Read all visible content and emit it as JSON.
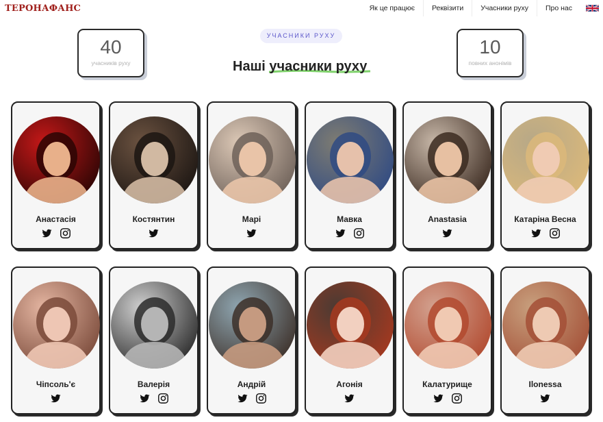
{
  "header": {
    "logo": "ТЕРОНАФАНС",
    "nav": [
      "Як це працює",
      "Реквізити",
      "Учасники руху",
      "Про нас"
    ],
    "language_flag": "uk-flag-icon"
  },
  "stats": {
    "members": {
      "value": "40",
      "label": "учасників руху"
    },
    "anonymous": {
      "value": "10",
      "label": "повних анонімів"
    }
  },
  "section": {
    "tag": "УЧАСНИКИ РУХУ",
    "title": "Наші учасники руху"
  },
  "colors": {
    "accent": "#5a55c9",
    "underline": "#7fd16b",
    "logo": "#a0201c"
  },
  "members": [
    {
      "name": "Анастасія",
      "twitter": true,
      "instagram": true,
      "photo_colors": [
        "#c41818",
        "#2a0504",
        "#e8b08a"
      ]
    },
    {
      "name": "Костянтин",
      "twitter": true,
      "instagram": false,
      "photo_colors": [
        "#6b5240",
        "#1b1512",
        "#d1b9a2"
      ]
    },
    {
      "name": "Марі",
      "twitter": true,
      "instagram": false,
      "photo_colors": [
        "#dcc8b6",
        "#6d6058",
        "#e9c4a8"
      ]
    },
    {
      "name": "Мавка",
      "twitter": true,
      "instagram": true,
      "photo_colors": [
        "#7e7c72",
        "#2f4a83",
        "#e6c1ab"
      ]
    },
    {
      "name": "Anastasia",
      "twitter": true,
      "instagram": false,
      "photo_colors": [
        "#c7b7a8",
        "#3b2a20",
        "#e7c0a2"
      ]
    },
    {
      "name": "Катаріна Весна",
      "twitter": true,
      "instagram": true,
      "photo_colors": [
        "#b7a887",
        "#dcb97a",
        "#f0cbb3"
      ]
    },
    {
      "name": "Чіпсоль'є",
      "twitter": true,
      "instagram": false,
      "photo_colors": [
        "#e4b5a1",
        "#7a4a3a",
        "#eec6b4"
      ]
    },
    {
      "name": "Валерія",
      "twitter": true,
      "instagram": true,
      "photo_colors": [
        "#cfcfcf",
        "#2a2a2a",
        "#b5b5b5"
      ]
    },
    {
      "name": "Андрій",
      "twitter": true,
      "instagram": true,
      "photo_colors": [
        "#8fa6b1",
        "#3c2f28",
        "#c59a80"
      ]
    },
    {
      "name": "Агонія",
      "twitter": true,
      "instagram": false,
      "photo_colors": [
        "#4b3a33",
        "#a7391f",
        "#f2d0c0"
      ]
    },
    {
      "name": "Калатурище",
      "twitter": true,
      "instagram": true,
      "photo_colors": [
        "#d3a290",
        "#b1492e",
        "#f0c9b2"
      ]
    },
    {
      "name": "Ilonessa",
      "twitter": true,
      "instagram": false,
      "photo_colors": [
        "#c8a07e",
        "#a34f36",
        "#eecab3"
      ]
    }
  ]
}
